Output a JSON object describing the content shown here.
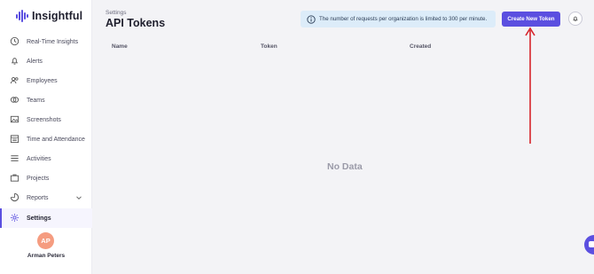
{
  "brand": {
    "name": "Insightful",
    "accent": "#5b4fe0"
  },
  "sidebar": {
    "items": [
      {
        "label": "Real-Time Insights",
        "icon": "clock-icon"
      },
      {
        "label": "Alerts",
        "icon": "bell-icon"
      },
      {
        "label": "Employees",
        "icon": "people-icon"
      },
      {
        "label": "Teams",
        "icon": "teams-icon"
      },
      {
        "label": "Screenshots",
        "icon": "screenshots-icon"
      },
      {
        "label": "Time and Attendance",
        "icon": "calendar-icon"
      },
      {
        "label": "Activities",
        "icon": "list-icon"
      },
      {
        "label": "Projects",
        "icon": "briefcase-icon"
      },
      {
        "label": "Reports",
        "icon": "reports-icon"
      },
      {
        "label": "Settings",
        "icon": "gear-icon"
      }
    ],
    "active": "Settings"
  },
  "user": {
    "initials": "AP",
    "name": "Arman Peters",
    "avatar_color": "#f59c80"
  },
  "header": {
    "breadcrumb": "Settings",
    "title": "API Tokens",
    "info_text": "The number of requests per organization is limited to 300 per minute.",
    "create_button": "Create New Token"
  },
  "table": {
    "columns": [
      "Name",
      "Token",
      "Created"
    ],
    "empty_text": "No Data"
  }
}
